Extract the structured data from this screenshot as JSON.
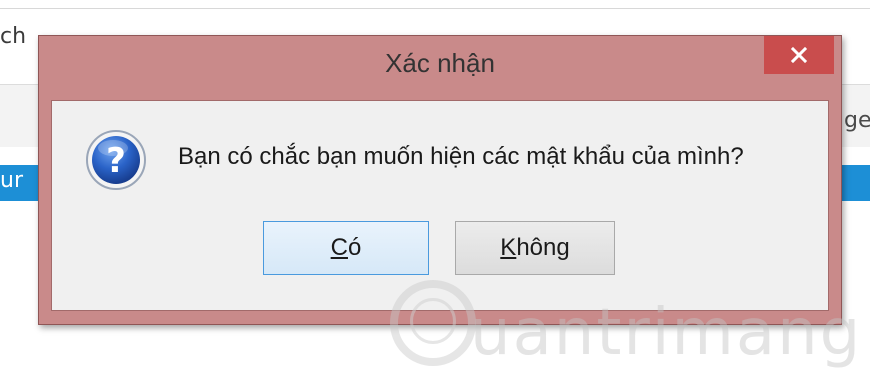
{
  "background": {
    "left_text_1": "ch",
    "left_text_2": "ur",
    "right_text_1": "ge"
  },
  "dialog": {
    "title": "Xác nhận",
    "close_glyph": "close-icon",
    "message": "Bạn có chắc bạn muốn hiện các mật khẩu của mình?",
    "icon": "question-icon",
    "buttons": {
      "yes": {
        "mnemonic": "C",
        "rest": "ó"
      },
      "no": {
        "mnemonic": "K",
        "rest": "hông"
      }
    }
  },
  "watermark": {
    "text": "uantrimang"
  },
  "colors": {
    "dialog_frame": "#c98a8a",
    "close_button": "#c94d4d",
    "dialog_body": "#f0f0f0",
    "default_button_border": "#4a9ade",
    "background_bar": "#1d8fd6"
  }
}
